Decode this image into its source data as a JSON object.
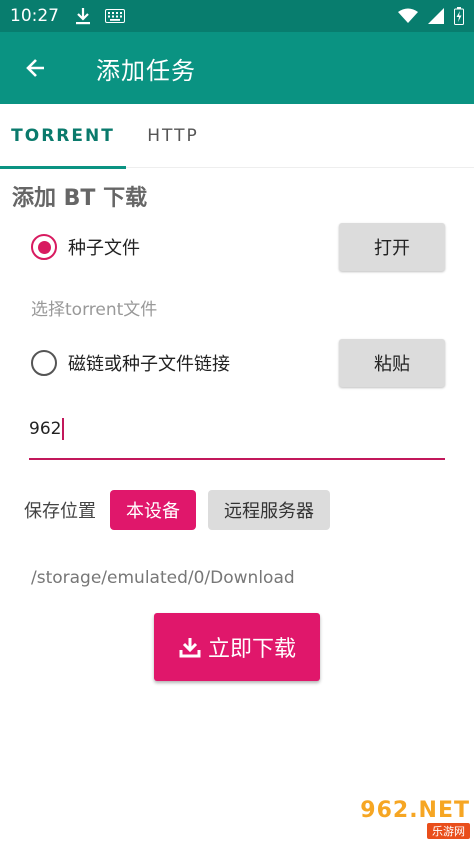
{
  "status_bar": {
    "time": "10:27",
    "icons_left": [
      "download-icon",
      "keyboard-icon"
    ],
    "icons_right": [
      "wifi-icon",
      "signal-icon",
      "battery-icon"
    ]
  },
  "app_bar": {
    "title": "添加任务",
    "background": "#0a9382"
  },
  "tabs": [
    {
      "label": "TORRENT",
      "selected": true
    },
    {
      "label": "HTTP",
      "selected": false
    }
  ],
  "section_title": "添加 BT 下载",
  "options": {
    "torrent_file": {
      "label": "种子文件",
      "checked": true,
      "button_label": "打开"
    },
    "hint": "选择torrent文件",
    "magnet_link": {
      "label": "磁链或种子文件链接",
      "checked": false,
      "button_label": "粘贴"
    }
  },
  "link_input": {
    "value": "962"
  },
  "save_location": {
    "label": "保存位置",
    "local_label": "本设备",
    "remote_label": "远程服务器",
    "path": "/storage/emulated/0/Download"
  },
  "download_button": {
    "label": "立即下载"
  },
  "watermark": {
    "main": "962.NET",
    "sub": "乐游网"
  },
  "colors": {
    "accent": "#e0176b",
    "primary": "#0a9382",
    "primary_dark": "#087d6e"
  }
}
